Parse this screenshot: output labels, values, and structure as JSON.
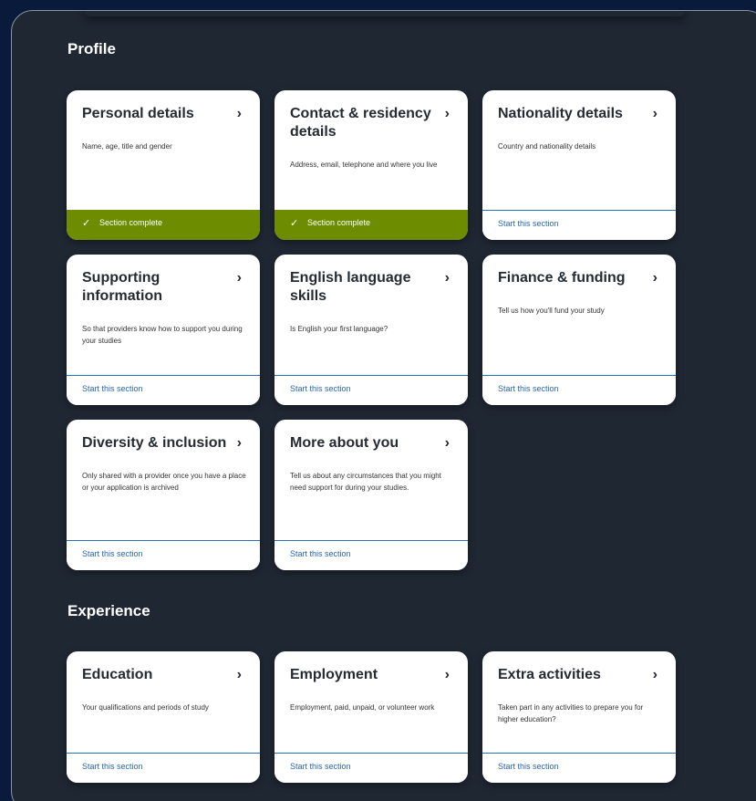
{
  "sections": {
    "profile_title": "Profile",
    "experience_title": "Experience"
  },
  "footer_labels": {
    "start": "Start this section",
    "complete": "Section complete"
  },
  "icons": {
    "chevron": "chevron-right-icon",
    "check": "checkmark-icon"
  },
  "colors": {
    "page_bg": "#0a1a3a",
    "panel_bg": "#1f2733",
    "complete_green": "#6e8c00",
    "link_blue": "#2a66b0"
  },
  "cards": {
    "personal": {
      "title": "Personal details",
      "desc": "Name, age, title and gender",
      "status": "Section complete"
    },
    "contact": {
      "title": "Contact & residency details",
      "desc": "Address, email, telephone and where you live",
      "status": "Section complete"
    },
    "nationality": {
      "title": "Nationality details",
      "desc": "Country and nationality details",
      "status": "Start this section"
    },
    "supporting": {
      "title": "Supporting information",
      "desc": "So that providers know how to support you during your studies",
      "status": "Start this section"
    },
    "english": {
      "title": "English language skills",
      "desc": "Is English your first language?",
      "status": "Start this section"
    },
    "finance": {
      "title": "Finance & funding",
      "desc": "Tell us how you'll fund your study",
      "status": "Start this section"
    },
    "diversity": {
      "title": "Diversity & inclusion",
      "desc": "Only shared with a provider once you have a place or your application is archived",
      "status": "Start this section"
    },
    "more": {
      "title": "More about you",
      "desc": "Tell us about any circumstances that you might need support for during your studies.",
      "status": "Start this section"
    },
    "education": {
      "title": "Education",
      "desc": "Your qualifications and periods of study",
      "status": "Start this section"
    },
    "employment": {
      "title": "Employment",
      "desc": "Employment, paid, unpaid, or volunteer work",
      "status": "Start this section"
    },
    "extra": {
      "title": "Extra activities",
      "desc": "Taken part in any activities to prepare you for higher education?",
      "status": "Start this section"
    }
  }
}
